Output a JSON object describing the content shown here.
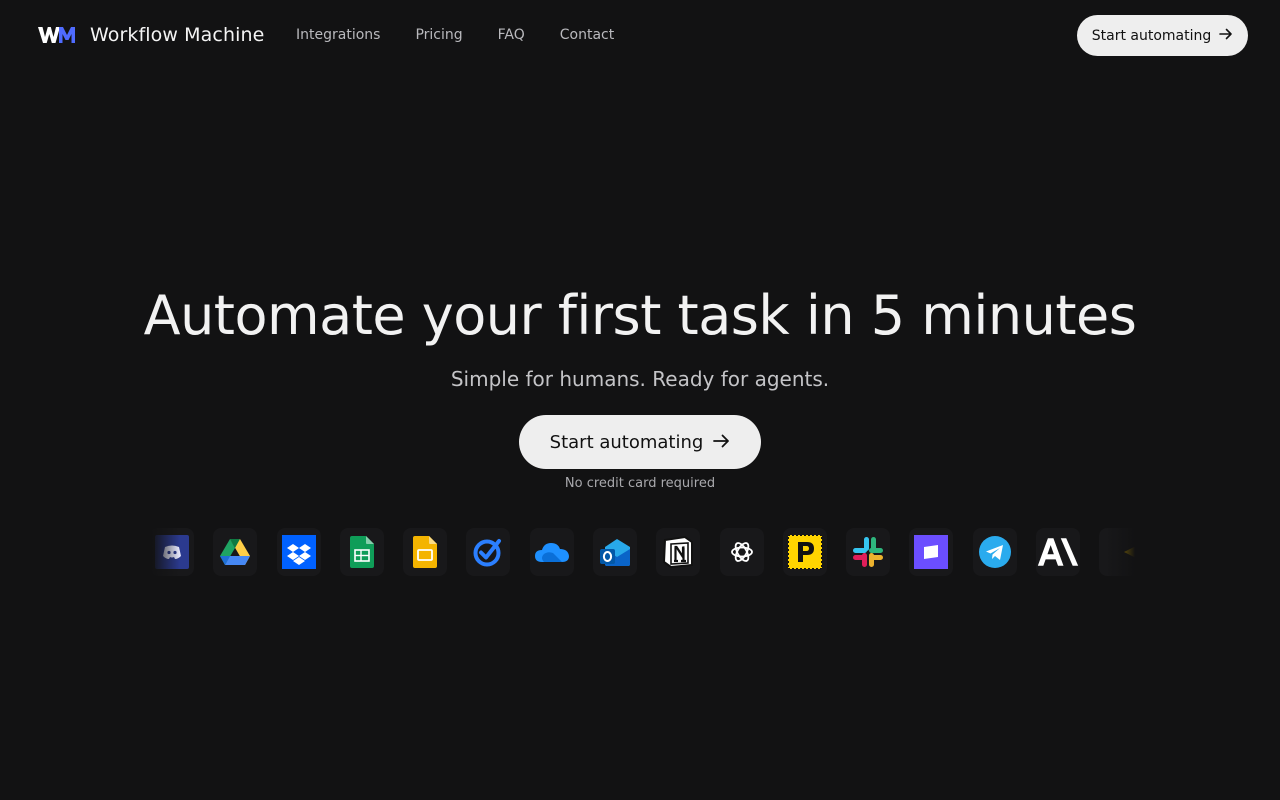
{
  "header": {
    "brand": "Workflow Machine",
    "nav": [
      {
        "label": "Integrations"
      },
      {
        "label": "Pricing"
      },
      {
        "label": "FAQ"
      },
      {
        "label": "Contact"
      }
    ],
    "cta_label": "Start automating",
    "cta_icon": "arrow-right-icon"
  },
  "hero": {
    "title": "Automate your first task in 5 minutes",
    "subtitle": "Simple for humans. Ready for agents.",
    "cta_label": "Start automating",
    "note": "No credit card required"
  },
  "integrations": [
    {
      "icon": "discord-icon",
      "color": "#5865F2"
    },
    {
      "icon": "google-drive-icon",
      "color": "#1FA463"
    },
    {
      "icon": "dropbox-icon",
      "color": "#0061FF"
    },
    {
      "icon": "google-sheets-icon",
      "color": "#0F9D58"
    },
    {
      "icon": "google-slides-icon",
      "color": "#F4B400"
    },
    {
      "icon": "todo-check-icon",
      "color": "#2B7FFF"
    },
    {
      "icon": "onedrive-icon",
      "color": "#1E90FF"
    },
    {
      "icon": "outlook-icon",
      "color": "#0A64C8"
    },
    {
      "icon": "notion-icon",
      "color": "#FFFFFF"
    },
    {
      "icon": "openai-icon",
      "color": "#FFFFFF"
    },
    {
      "icon": "product-hunt-p-icon",
      "color": "#FFD400"
    },
    {
      "icon": "slack-icon",
      "color": "#E01E5A"
    },
    {
      "icon": "chat-square-icon",
      "color": "#6B4EFF"
    },
    {
      "icon": "telegram-icon",
      "color": "#2AABEE"
    },
    {
      "icon": "anthropic-icon",
      "color": "#FFFFFF"
    },
    {
      "icon": "partial-icon",
      "color": "#C8A000"
    }
  ],
  "colors": {
    "background": "#121213",
    "button_bg": "#EEEEEE",
    "logo_w": "#FFFFFF",
    "logo_m": "#4F6BFF"
  }
}
